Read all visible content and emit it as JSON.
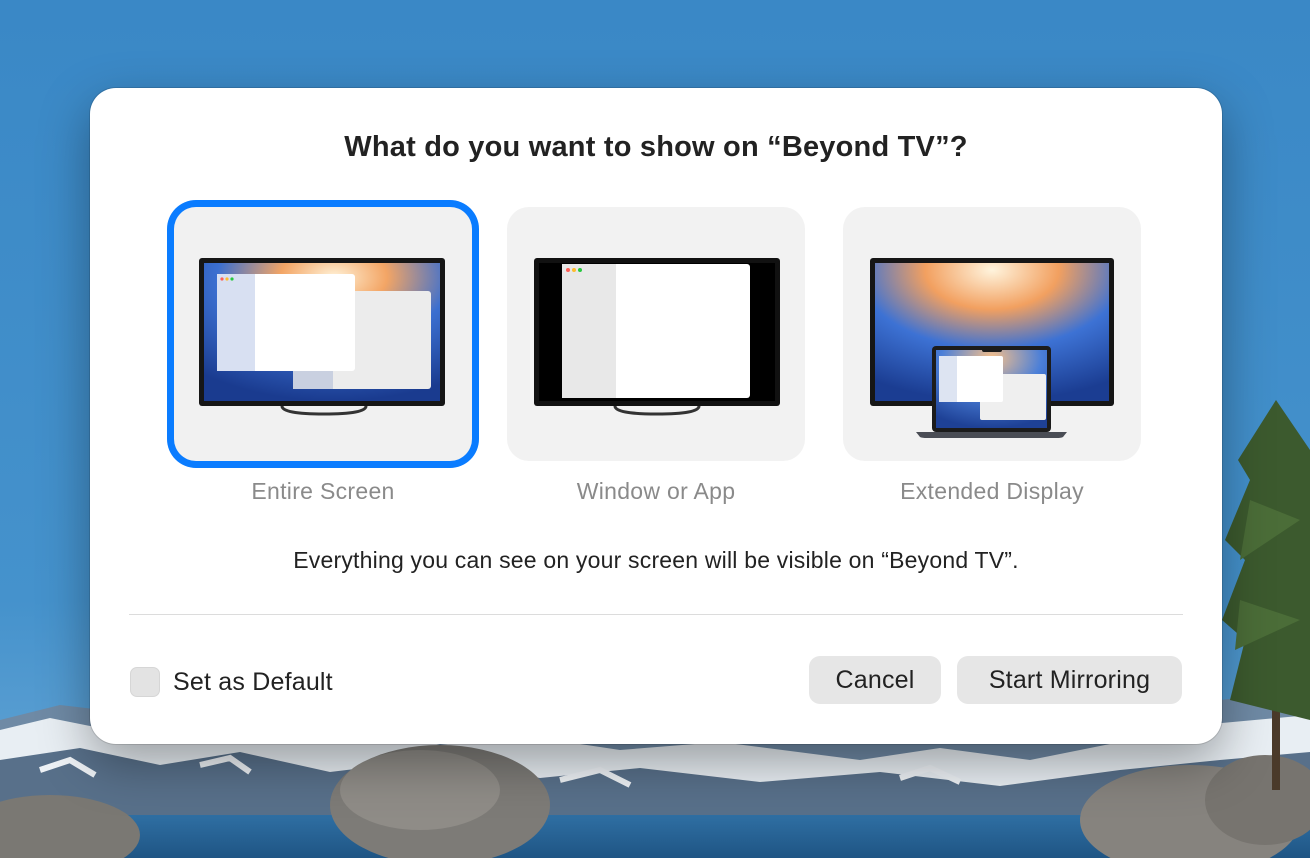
{
  "dialog": {
    "title": "What do you want to show on “Beyond TV”?",
    "options": [
      {
        "label": "Entire Screen",
        "icon": "tv-entire-screen-icon",
        "selected": true
      },
      {
        "label": "Window or App",
        "icon": "tv-window-app-icon",
        "selected": false
      },
      {
        "label": "Extended Display",
        "icon": "tv-extended-display-icon",
        "selected": false
      }
    ],
    "description": "Everything you can see on your screen will be visible on “Beyond TV”.",
    "checkbox_label": "Set as Default",
    "checkbox_checked": false,
    "cancel_label": "Cancel",
    "start_label": "Start Mirroring"
  },
  "colors": {
    "accent": "#0a7cff",
    "dialog_bg": "#ffffff",
    "tile_bg": "#f2f2f2"
  }
}
